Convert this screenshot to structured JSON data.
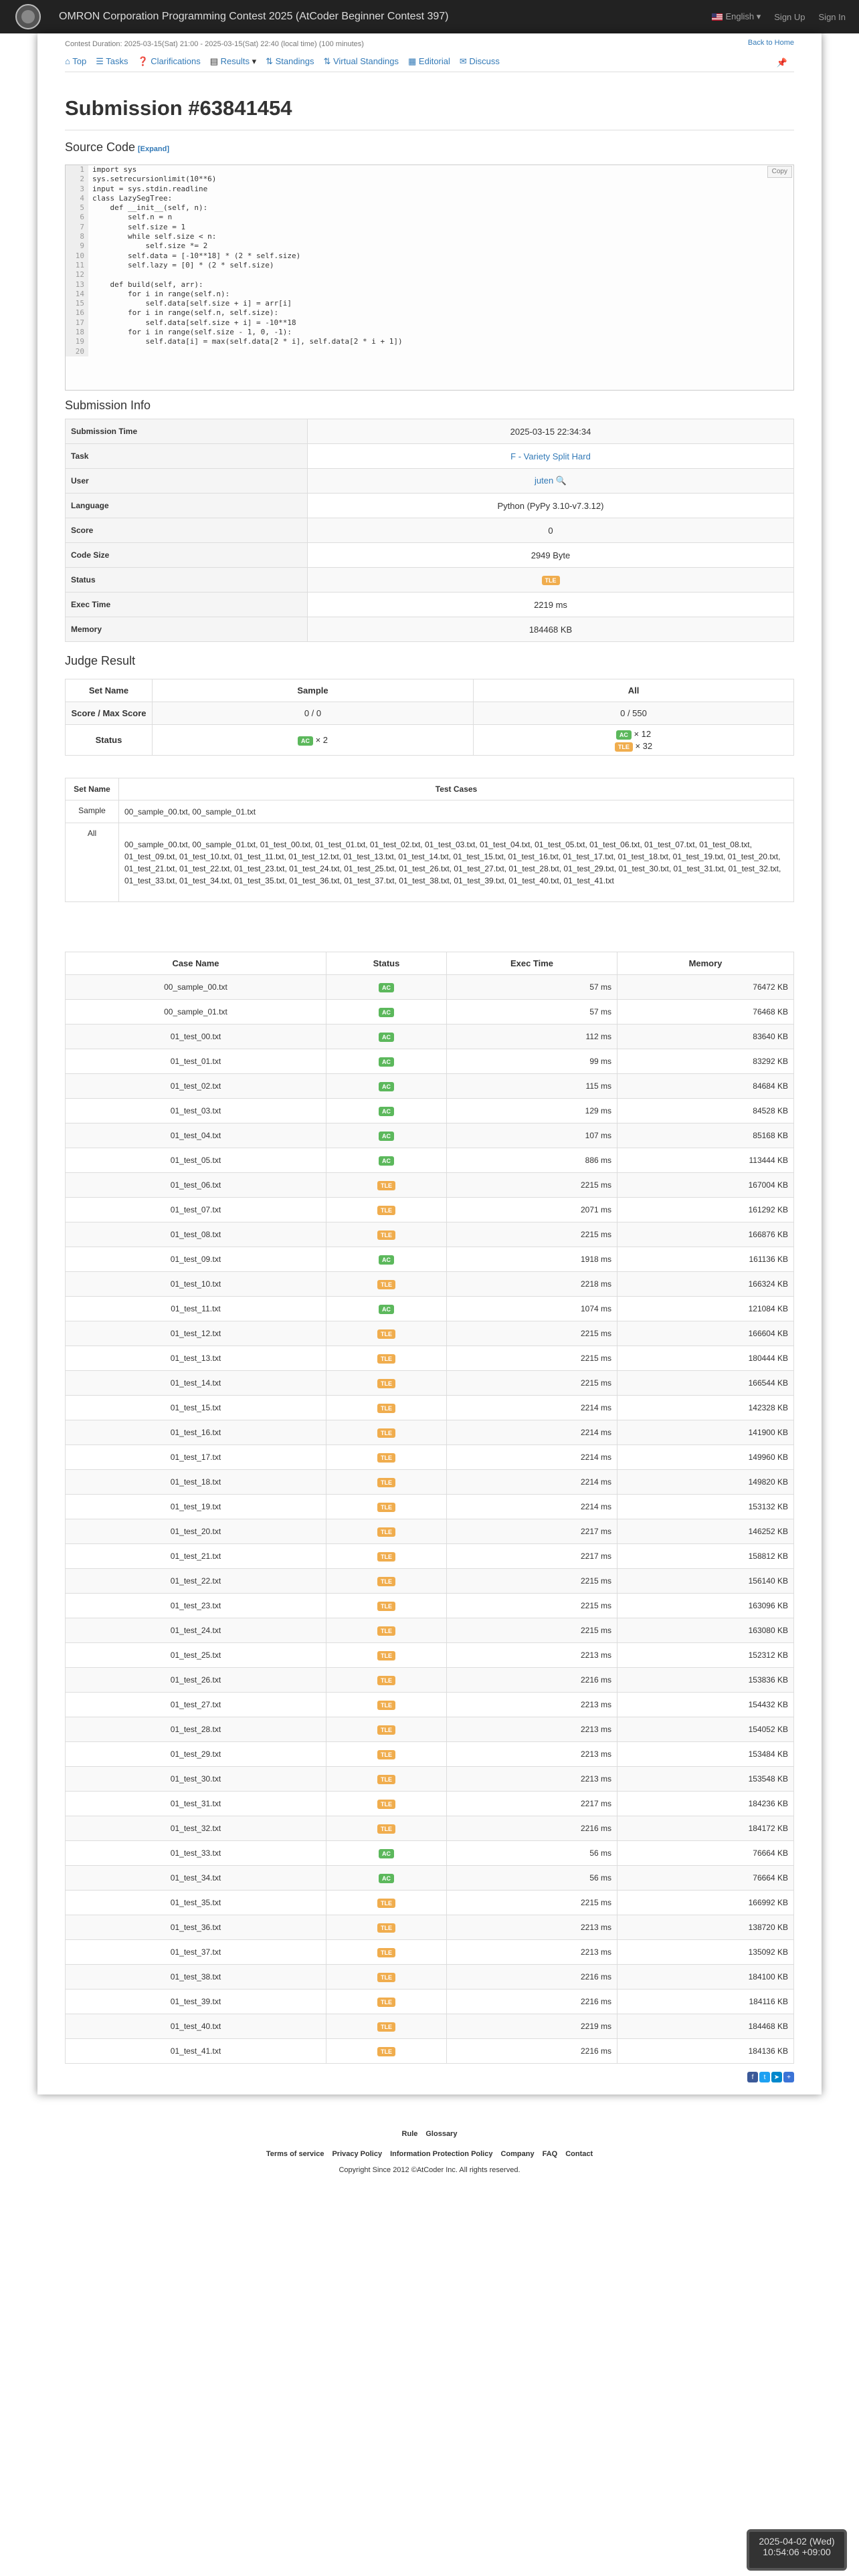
{
  "nav": {
    "title": "OMRON Corporation Programming Contest 2025 (AtCoder Beginner Contest 397)",
    "language": "English",
    "signup": "Sign Up",
    "signin": "Sign In"
  },
  "contest": {
    "duration": "Contest Duration: 2025-03-15(Sat) 21:00 - 2025-03-15(Sat) 22:40 (local time) (100 minutes)",
    "back_home": "Back to Home"
  },
  "tabs": [
    "Top",
    "Tasks",
    "Clarifications",
    "Results",
    "Standings",
    "Virtual Standings",
    "Editorial",
    "Discuss"
  ],
  "title": "Submission #63841454",
  "source": {
    "heading": "Source Code",
    "expand": "[Expand]",
    "copy": "Copy",
    "lines": [
      "import sys",
      "sys.setrecursionlimit(10**6)",
      "input = sys.stdin.readline",
      "class LazySegTree:",
      "    def __init__(self, n):",
      "        self.n = n",
      "        self.size = 1",
      "        while self.size < n:",
      "            self.size *= 2",
      "        self.data = [-10**18] * (2 * self.size)",
      "        self.lazy = [0] * (2 * self.size)",
      "",
      "    def build(self, arr):",
      "        for i in range(self.n):",
      "            self.data[self.size + i] = arr[i]",
      "        for i in range(self.n, self.size):",
      "            self.data[self.size + i] = -10**18",
      "        for i in range(self.size - 1, 0, -1):",
      "            self.data[i] = max(self.data[2 * i], self.data[2 * i + 1])",
      ""
    ]
  },
  "info": {
    "heading": "Submission Info",
    "rows": [
      {
        "k": "Submission Time",
        "v": "2025-03-15 22:34:34"
      },
      {
        "k": "Task",
        "v": "F - Variety Split Hard"
      },
      {
        "k": "User",
        "v": "juten"
      },
      {
        "k": "Language",
        "v": "Python (PyPy 3.10-v7.3.12)"
      },
      {
        "k": "Score",
        "v": "0"
      },
      {
        "k": "Code Size",
        "v": "2949 Byte"
      },
      {
        "k": "Status",
        "v": "TLE"
      },
      {
        "k": "Exec Time",
        "v": "2219 ms"
      },
      {
        "k": "Memory",
        "v": "184468 KB"
      }
    ]
  },
  "judge": {
    "heading": "Judge Result",
    "headers": [
      "Set Name",
      "Sample",
      "All"
    ],
    "score_label": "Score / Max Score",
    "score_sample": "0 / 0",
    "score_all": "0 / 550",
    "status_label": "Status",
    "sample_status": "× 2",
    "all_ac": "× 12",
    "all_tle": "× 32"
  },
  "cases": {
    "headers": [
      "Set Name",
      "Test Cases"
    ],
    "sample_name": "Sample",
    "sample_list": "00_sample_00.txt, 00_sample_01.txt",
    "all_name": "All",
    "all_list": "00_sample_00.txt, 00_sample_01.txt, 01_test_00.txt, 01_test_01.txt, 01_test_02.txt, 01_test_03.txt, 01_test_04.txt, 01_test_05.txt, 01_test_06.txt, 01_test_07.txt, 01_test_08.txt, 01_test_09.txt, 01_test_10.txt, 01_test_11.txt, 01_test_12.txt, 01_test_13.txt, 01_test_14.txt, 01_test_15.txt, 01_test_16.txt, 01_test_17.txt, 01_test_18.txt, 01_test_19.txt, 01_test_20.txt, 01_test_21.txt, 01_test_22.txt, 01_test_23.txt, 01_test_24.txt, 01_test_25.txt, 01_test_26.txt, 01_test_27.txt, 01_test_28.txt, 01_test_29.txt, 01_test_30.txt, 01_test_31.txt, 01_test_32.txt, 01_test_33.txt, 01_test_34.txt, 01_test_35.txt, 01_test_36.txt, 01_test_37.txt, 01_test_38.txt, 01_test_39.txt, 01_test_40.txt, 01_test_41.txt"
  },
  "detail": {
    "headers": [
      "Case Name",
      "Status",
      "Exec Time",
      "Memory"
    ],
    "rows": [
      [
        "00_sample_00.txt",
        "AC",
        "57 ms",
        "76472 KB"
      ],
      [
        "00_sample_01.txt",
        "AC",
        "57 ms",
        "76468 KB"
      ],
      [
        "01_test_00.txt",
        "AC",
        "112 ms",
        "83640 KB"
      ],
      [
        "01_test_01.txt",
        "AC",
        "99 ms",
        "83292 KB"
      ],
      [
        "01_test_02.txt",
        "AC",
        "115 ms",
        "84684 KB"
      ],
      [
        "01_test_03.txt",
        "AC",
        "129 ms",
        "84528 KB"
      ],
      [
        "01_test_04.txt",
        "AC",
        "107 ms",
        "85168 KB"
      ],
      [
        "01_test_05.txt",
        "AC",
        "886 ms",
        "113444 KB"
      ],
      [
        "01_test_06.txt",
        "TLE",
        "2215 ms",
        "167004 KB"
      ],
      [
        "01_test_07.txt",
        "TLE",
        "2071 ms",
        "161292 KB"
      ],
      [
        "01_test_08.txt",
        "TLE",
        "2215 ms",
        "166876 KB"
      ],
      [
        "01_test_09.txt",
        "AC",
        "1918 ms",
        "161136 KB"
      ],
      [
        "01_test_10.txt",
        "TLE",
        "2218 ms",
        "166324 KB"
      ],
      [
        "01_test_11.txt",
        "AC",
        "1074 ms",
        "121084 KB"
      ],
      [
        "01_test_12.txt",
        "TLE",
        "2215 ms",
        "166604 KB"
      ],
      [
        "01_test_13.txt",
        "TLE",
        "2215 ms",
        "180444 KB"
      ],
      [
        "01_test_14.txt",
        "TLE",
        "2215 ms",
        "166544 KB"
      ],
      [
        "01_test_15.txt",
        "TLE",
        "2214 ms",
        "142328 KB"
      ],
      [
        "01_test_16.txt",
        "TLE",
        "2214 ms",
        "141900 KB"
      ],
      [
        "01_test_17.txt",
        "TLE",
        "2214 ms",
        "149960 KB"
      ],
      [
        "01_test_18.txt",
        "TLE",
        "2214 ms",
        "149820 KB"
      ],
      [
        "01_test_19.txt",
        "TLE",
        "2214 ms",
        "153132 KB"
      ],
      [
        "01_test_20.txt",
        "TLE",
        "2217 ms",
        "146252 KB"
      ],
      [
        "01_test_21.txt",
        "TLE",
        "2217 ms",
        "158812 KB"
      ],
      [
        "01_test_22.txt",
        "TLE",
        "2215 ms",
        "156140 KB"
      ],
      [
        "01_test_23.txt",
        "TLE",
        "2215 ms",
        "163096 KB"
      ],
      [
        "01_test_24.txt",
        "TLE",
        "2215 ms",
        "163080 KB"
      ],
      [
        "01_test_25.txt",
        "TLE",
        "2213 ms",
        "152312 KB"
      ],
      [
        "01_test_26.txt",
        "TLE",
        "2216 ms",
        "153836 KB"
      ],
      [
        "01_test_27.txt",
        "TLE",
        "2213 ms",
        "154432 KB"
      ],
      [
        "01_test_28.txt",
        "TLE",
        "2213 ms",
        "154052 KB"
      ],
      [
        "01_test_29.txt",
        "TLE",
        "2213 ms",
        "153484 KB"
      ],
      [
        "01_test_30.txt",
        "TLE",
        "2213 ms",
        "153548 KB"
      ],
      [
        "01_test_31.txt",
        "TLE",
        "2217 ms",
        "184236 KB"
      ],
      [
        "01_test_32.txt",
        "TLE",
        "2216 ms",
        "184172 KB"
      ],
      [
        "01_test_33.txt",
        "AC",
        "56 ms",
        "76664 KB"
      ],
      [
        "01_test_34.txt",
        "AC",
        "56 ms",
        "76664 KB"
      ],
      [
        "01_test_35.txt",
        "TLE",
        "2215 ms",
        "166992 KB"
      ],
      [
        "01_test_36.txt",
        "TLE",
        "2213 ms",
        "138720 KB"
      ],
      [
        "01_test_37.txt",
        "TLE",
        "2213 ms",
        "135092 KB"
      ],
      [
        "01_test_38.txt",
        "TLE",
        "2216 ms",
        "184100 KB"
      ],
      [
        "01_test_39.txt",
        "TLE",
        "2216 ms",
        "184116 KB"
      ],
      [
        "01_test_40.txt",
        "TLE",
        "2219 ms",
        "184468 KB"
      ],
      [
        "01_test_41.txt",
        "TLE",
        "2216 ms",
        "184136 KB"
      ]
    ]
  },
  "footer": {
    "links1": [
      "Rule",
      "Glossary"
    ],
    "links2": [
      "Terms of service",
      "Privacy Policy",
      "Information Protection Policy",
      "Company",
      "FAQ",
      "Contact"
    ],
    "copyright": "Copyright Since 2012 ©AtCoder Inc. All rights reserved."
  },
  "clock": {
    "date": "2025-04-02 (Wed)",
    "time": "10:54:06 +09:00"
  },
  "colors": {
    "ac": "#5cb85c",
    "tle": "#f0ad4e",
    "link": "#337ab7",
    "navbar": "#222222"
  }
}
